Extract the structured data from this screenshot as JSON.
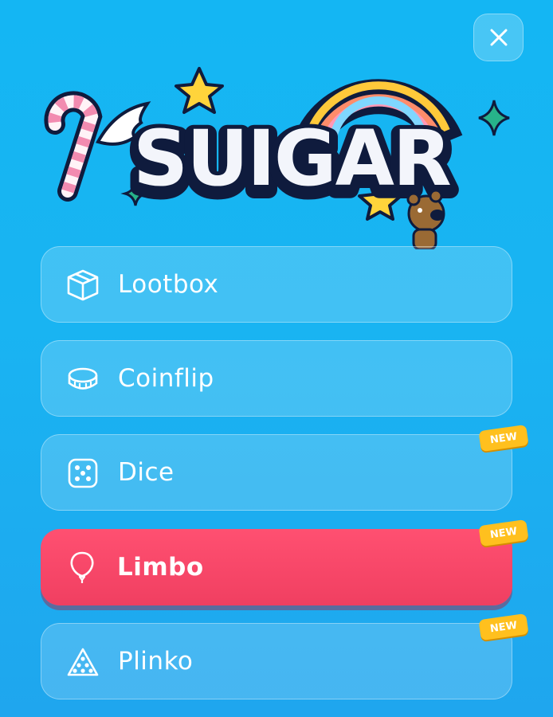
{
  "brand": {
    "logo_text": "SUIGAR"
  },
  "header": {
    "close_icon": "close-icon"
  },
  "menu": {
    "items": [
      {
        "label": "Lootbox",
        "icon": "box-icon",
        "active": false,
        "badge": ""
      },
      {
        "label": "Coinflip",
        "icon": "coin-icon",
        "active": false,
        "badge": ""
      },
      {
        "label": "Dice",
        "icon": "dice-icon",
        "active": false,
        "badge": "NEW"
      },
      {
        "label": "Limbo",
        "icon": "balloon-icon",
        "active": true,
        "badge": "NEW"
      },
      {
        "label": "Plinko",
        "icon": "plinko-icon",
        "active": false,
        "badge": "NEW"
      }
    ]
  },
  "colors": {
    "background": "#16b3f2",
    "active_item": "#f5476a",
    "badge": "#ffc01e",
    "text": "#ffffff"
  }
}
